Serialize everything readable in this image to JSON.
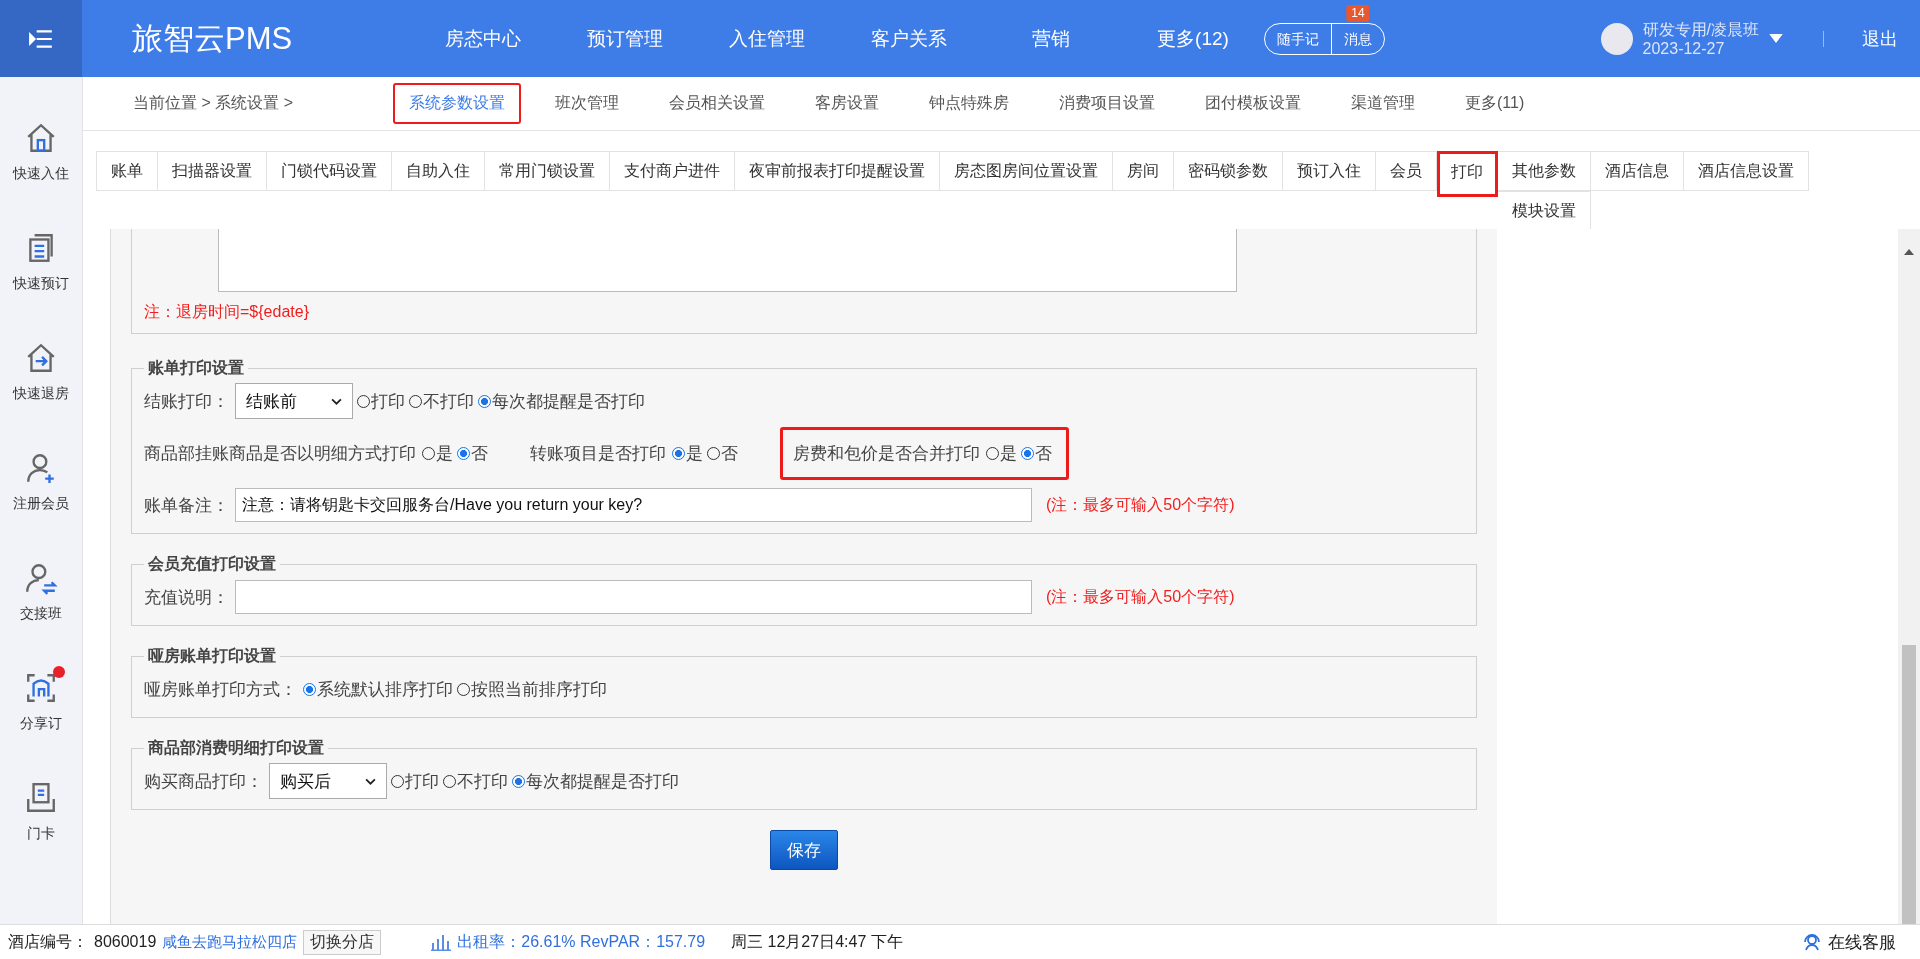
{
  "topbar": {
    "logo": "旅智云PMS",
    "nav": [
      {
        "label": "房态中心"
      },
      {
        "label": "预订管理"
      },
      {
        "label": "入住管理"
      },
      {
        "label": "客户关系"
      },
      {
        "label": "营销"
      },
      {
        "label": "更多(12)"
      }
    ],
    "notes_button": "随手记",
    "messages_button": "消息",
    "messages_badge": "14",
    "user_name": "研发专用/凌晨班",
    "user_date": "2023-12-27",
    "logout": "退出"
  },
  "sidebar": {
    "items": [
      {
        "label": "快速入住",
        "kind": "house",
        "dot": false
      },
      {
        "label": "快速预订",
        "kind": "docs",
        "dot": false
      },
      {
        "label": "快速退房",
        "kind": "checkout",
        "dot": false
      },
      {
        "label": "注册会员",
        "kind": "useradd",
        "dot": false
      },
      {
        "label": "交接班",
        "kind": "userswap",
        "dot": false
      },
      {
        "label": "分享订",
        "kind": "scan",
        "dot": true
      },
      {
        "label": "门卡",
        "kind": "card",
        "dot": false
      }
    ]
  },
  "breadcrumb": {
    "label": "当前位置 > 系统设置 >",
    "tabs": [
      {
        "label": "系统参数设置",
        "selected": true,
        "highlighted": true
      },
      {
        "label": "班次管理",
        "selected": false,
        "highlighted": false
      },
      {
        "label": "会员相关设置",
        "selected": false,
        "highlighted": false
      },
      {
        "label": "客房设置",
        "selected": false,
        "highlighted": false
      },
      {
        "label": "钟点特殊房",
        "selected": false,
        "highlighted": false
      },
      {
        "label": "消费项目设置",
        "selected": false,
        "highlighted": false
      },
      {
        "label": "团付模板设置",
        "selected": false,
        "highlighted": false
      },
      {
        "label": "渠道管理",
        "selected": false,
        "highlighted": false
      },
      {
        "label": "更多(11)",
        "selected": false,
        "highlighted": false
      }
    ]
  },
  "tabs": [
    {
      "label": "账单",
      "selected": false,
      "highlighted": false
    },
    {
      "label": "扫描器设置",
      "selected": false,
      "highlighted": false
    },
    {
      "label": "门锁代码设置",
      "selected": false,
      "highlighted": false
    },
    {
      "label": "自助入住",
      "selected": false,
      "highlighted": false
    },
    {
      "label": "常用门锁设置",
      "selected": false,
      "highlighted": false
    },
    {
      "label": "支付商户进件",
      "selected": false,
      "highlighted": false
    },
    {
      "label": "夜审前报表打印提醒设置",
      "selected": false,
      "highlighted": false
    },
    {
      "label": "房态图房间位置设置",
      "selected": false,
      "highlighted": false
    },
    {
      "label": "房间",
      "selected": false,
      "highlighted": false
    },
    {
      "label": "密码锁参数",
      "selected": false,
      "highlighted": false
    },
    {
      "label": "预订入住",
      "selected": false,
      "highlighted": false
    },
    {
      "label": "会员",
      "selected": false,
      "highlighted": false
    },
    {
      "label": "打印",
      "selected": true,
      "highlighted": true
    },
    {
      "label": "其他参数",
      "selected": false,
      "highlighted": false
    },
    {
      "label": "酒店信息",
      "selected": false,
      "highlighted": false
    },
    {
      "label": "酒店信息设置",
      "selected": false,
      "highlighted": false
    },
    {
      "label": "模块设置",
      "selected": false,
      "highlighted": false
    }
  ],
  "top_section": {
    "note": "注：退房时间=${edate}"
  },
  "sections": [
    {
      "title": "账单打印设置",
      "rows": [
        {
          "items": [
            {
              "kind": "label",
              "text": "结账打印："
            },
            {
              "kind": "select",
              "value": "结账前"
            },
            {
              "kind": "radios",
              "options": [
                {
                  "label": "打印",
                  "selected": false
                },
                {
                  "label": "不打印",
                  "selected": false
                },
                {
                  "label": "每次都提醒是否打印",
                  "selected": true
                }
              ]
            }
          ]
        },
        {
          "items": [
            {
              "kind": "label",
              "text": "商品部挂账商品是否以明细方式打印"
            },
            {
              "kind": "radios",
              "options": [
                {
                  "label": "是",
                  "selected": false
                },
                {
                  "label": "否",
                  "selected": true
                }
              ]
            },
            {
              "kind": "spacer"
            },
            {
              "kind": "label",
              "text": "转账项目是否打印"
            },
            {
              "kind": "radios",
              "options": [
                {
                  "label": "是",
                  "selected": true
                },
                {
                  "label": "否",
                  "selected": false
                }
              ]
            },
            {
              "kind": "spacer"
            },
            {
              "kind": "group",
              "highlighted": true,
              "items": [
                {
                  "kind": "label",
                  "text": "房费和包价是否合并打印"
                },
                {
                  "kind": "radios",
                  "options": [
                    {
                      "label": "是",
                      "selected": false
                    },
                    {
                      "label": "否",
                      "selected": true
                    }
                  ]
                }
              ]
            }
          ]
        },
        {
          "items": [
            {
              "kind": "label",
              "text": "账单备注："
            },
            {
              "kind": "input",
              "value": "注意：请将钥匙卡交回服务台/Have you return your key?"
            },
            {
              "kind": "note",
              "text": "(注：最多可输入50个字符)"
            }
          ]
        }
      ]
    },
    {
      "title": "会员充值打印设置",
      "rows": [
        {
          "items": [
            {
              "kind": "label",
              "text": "充值说明："
            },
            {
              "kind": "input",
              "value": ""
            },
            {
              "kind": "note",
              "text": "(注：最多可输入50个字符)"
            }
          ]
        }
      ]
    },
    {
      "title": "哑房账单打印设置",
      "rows": [
        {
          "items": [
            {
              "kind": "label",
              "text": "哑房账单打印方式："
            },
            {
              "kind": "radios",
              "options": [
                {
                  "label": "系统默认排序打印",
                  "selected": true
                },
                {
                  "label": "按照当前排序打印",
                  "selected": false
                }
              ]
            }
          ]
        }
      ]
    },
    {
      "title": "商品部消费明细打印设置",
      "rows": [
        {
          "items": [
            {
              "kind": "label",
              "text": "购买商品打印："
            },
            {
              "kind": "select",
              "value": "购买后"
            },
            {
              "kind": "radios",
              "options": [
                {
                  "label": "打印",
                  "selected": false
                },
                {
                  "label": "不打印",
                  "selected": false
                },
                {
                  "label": "每次都提醒是否打印",
                  "selected": true
                }
              ]
            }
          ]
        }
      ]
    }
  ],
  "save_button": "保存",
  "status_bar": {
    "hotel_label": "酒店编号：",
    "hotel_code": "8060019",
    "hotel_name": "咸鱼去跑马拉松四店",
    "switch_button": "切换分店",
    "occupancy": "出租率：26.61% RevPAR：157.79",
    "datetime": "周三 12月27日4:47 下午",
    "support": "在线客服"
  }
}
